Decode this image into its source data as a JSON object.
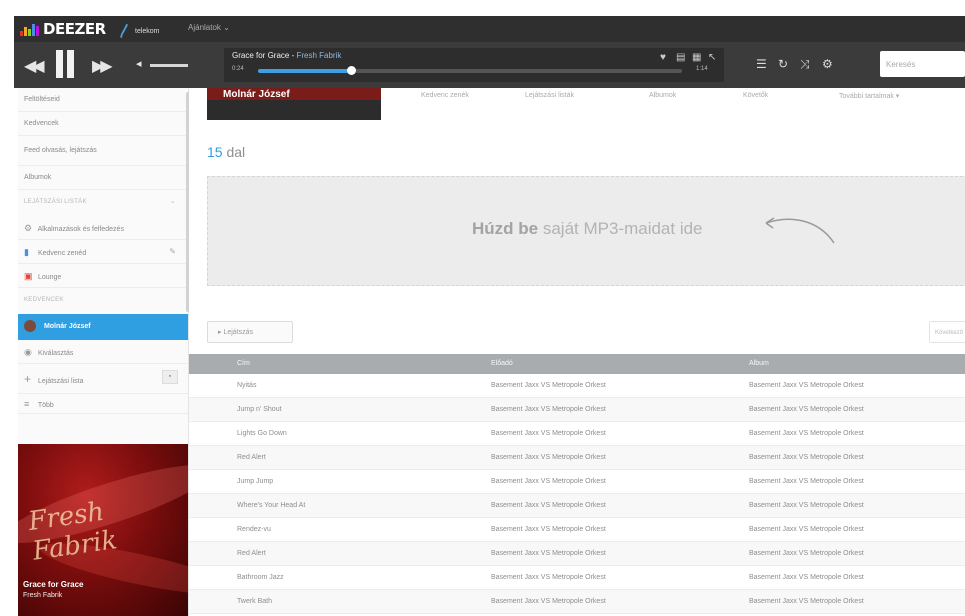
{
  "header": {
    "logo_text": "DEEZER",
    "partner_label": "telekom",
    "account_label": "Ajánlatok ⌄",
    "logo_bar_colors": [
      "#e8312b",
      "#f5a623",
      "#7ed321",
      "#4a90e2",
      "#bd10e0"
    ]
  },
  "player": {
    "track_title": "Grace for Grace",
    "separator": " - ",
    "track_artist": "Fresh Fabrik",
    "time_current": "0:24",
    "time_total": "1:14",
    "progress": 0.22,
    "search_placeholder": "Keresés"
  },
  "sidebar": {
    "items": [
      {
        "label": "Feltöltéseid",
        "icon": ""
      },
      {
        "label": "Kedvencek",
        "icon": ""
      },
      {
        "label": "Feed olvasás, lejátszás",
        "icon": ""
      },
      {
        "label": "Albumok",
        "icon": ""
      }
    ],
    "heading_1": "LEJÁTSZÁSI LISTÁK",
    "items2": [
      {
        "label": "Alkalmazások és felfedezés",
        "icon": "gear-icon"
      },
      {
        "label": "Kedvenc zenéd",
        "icon": "equalizer-icon"
      },
      {
        "label": "Lounge",
        "icon": "tv-icon"
      }
    ],
    "heading_2": "KEDVENCEK",
    "active_item": "Molnár József",
    "items3": [
      {
        "label": "Kiválasztás",
        "icon": "radio-icon"
      }
    ],
    "add_playlist_label": "Lejátszási lista",
    "more_label": "Több",
    "now_playing_title": "Grace for Grace",
    "now_playing_artist": "Fresh Fabrik",
    "cover_script": "Fresh Fabrik"
  },
  "main": {
    "artist_name": "Molnár József",
    "tabs": [
      "Kedvenc zenék",
      "Lejátszási listák",
      "Albumok",
      "Követők",
      "További tartalmak ▾"
    ],
    "song_count_number": "15",
    "song_count_label": " dal",
    "dropzone_bold": "Húzd be",
    "dropzone_rest": " saját MP3-maidat ide",
    "filter_label": "▸  Lejátszás",
    "page_label": "Következő",
    "table_headers": [
      "Cím",
      "Előadó",
      "Album"
    ],
    "rows": [
      [
        "Nyitás",
        "Basement Jaxx VS Metropole Orkest",
        "Basement Jaxx VS Metropole Orkest"
      ],
      [
        "Jump n' Shout",
        "Basement Jaxx VS Metropole Orkest",
        "Basement Jaxx VS Metropole Orkest"
      ],
      [
        "Lights Go Down",
        "Basement Jaxx VS Metropole Orkest",
        "Basement Jaxx VS Metropole Orkest"
      ],
      [
        "Red Alert",
        "Basement Jaxx VS Metropole Orkest",
        "Basement Jaxx VS Metropole Orkest"
      ],
      [
        "Jump Jump",
        "Basement Jaxx VS Metropole Orkest",
        "Basement Jaxx VS Metropole Orkest"
      ],
      [
        "Where's Your Head At",
        "Basement Jaxx VS Metropole Orkest",
        "Basement Jaxx VS Metropole Orkest"
      ],
      [
        "Rendez-vu",
        "Basement Jaxx VS Metropole Orkest",
        "Basement Jaxx VS Metropole Orkest"
      ],
      [
        "Red Alert",
        "Basement Jaxx VS Metropole Orkest",
        "Basement Jaxx VS Metropole Orkest"
      ],
      [
        "Bathroom Jazz",
        "Basement Jaxx VS Metropole Orkest",
        "Basement Jaxx VS Metropole Orkest"
      ],
      [
        "Twerk Bath",
        "Basement Jaxx VS Metropole Orkest",
        "Basement Jaxx VS Metropole Orkest"
      ]
    ]
  },
  "colors": {
    "accent": "#2f9fe1",
    "header_bg": "#2f2f2f",
    "player_bg": "#3b3b3b",
    "table_header": "#a9acae"
  }
}
